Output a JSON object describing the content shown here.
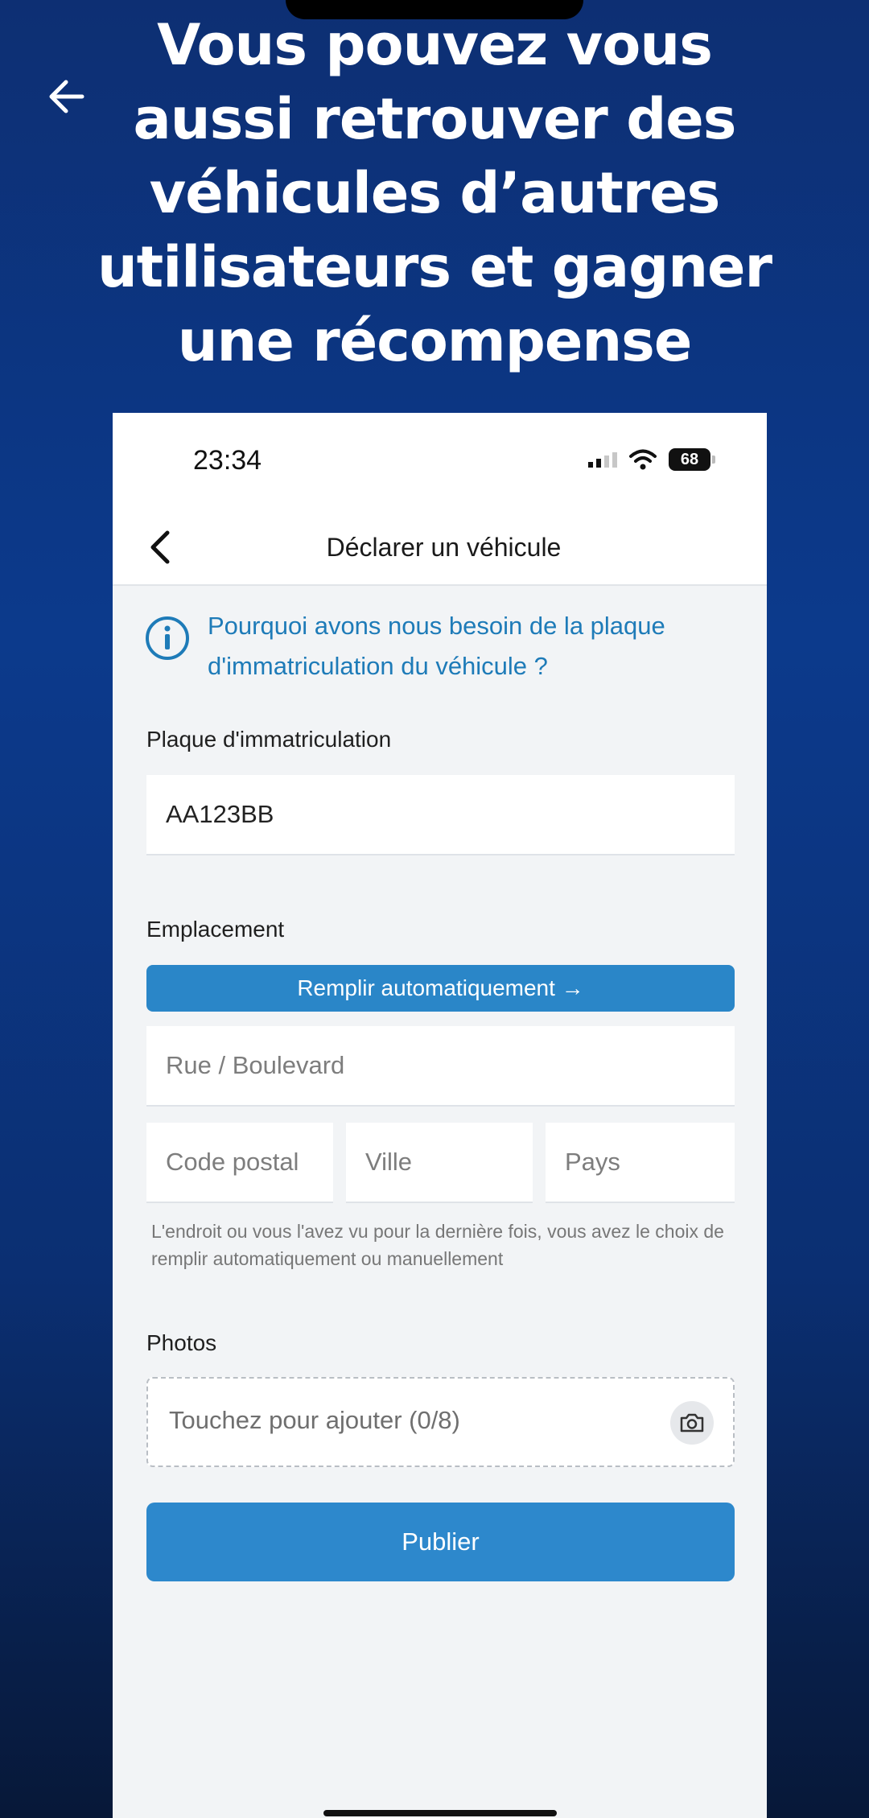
{
  "headline": "Vous pouvez vous aussi retrouver des véhicules d’autres utilisateurs et gagner une récompense",
  "phone": {
    "status": {
      "time": "23:34",
      "battery": "68"
    },
    "nav": {
      "title": "Déclarer un véhicule"
    },
    "info": {
      "text": "Pourquoi avons nous besoin de la plaque d'immatriculation du véhicule ?"
    },
    "plate": {
      "label": "Plaque d'immatriculation",
      "value": "AA123BB"
    },
    "location": {
      "label": "Emplacement",
      "autofill_label": "Remplir automatiquement →",
      "street_placeholder": "Rue / Boulevard",
      "postal_placeholder": "Code postal",
      "city_placeholder": "Ville",
      "country_placeholder": "Pays",
      "hint": "L'endroit ou vous l'avez vu pour la dernière fois, vous avez le choix de remplir automatiquement ou manuellement"
    },
    "photos": {
      "label": "Photos",
      "placeholder": "Touchez pour ajouter (0/8)"
    },
    "publish_label": "Publier"
  },
  "colors": {
    "accent": "#2a86c8",
    "info_text": "#1e7bb8",
    "background_blue": "#0c3a8c"
  }
}
